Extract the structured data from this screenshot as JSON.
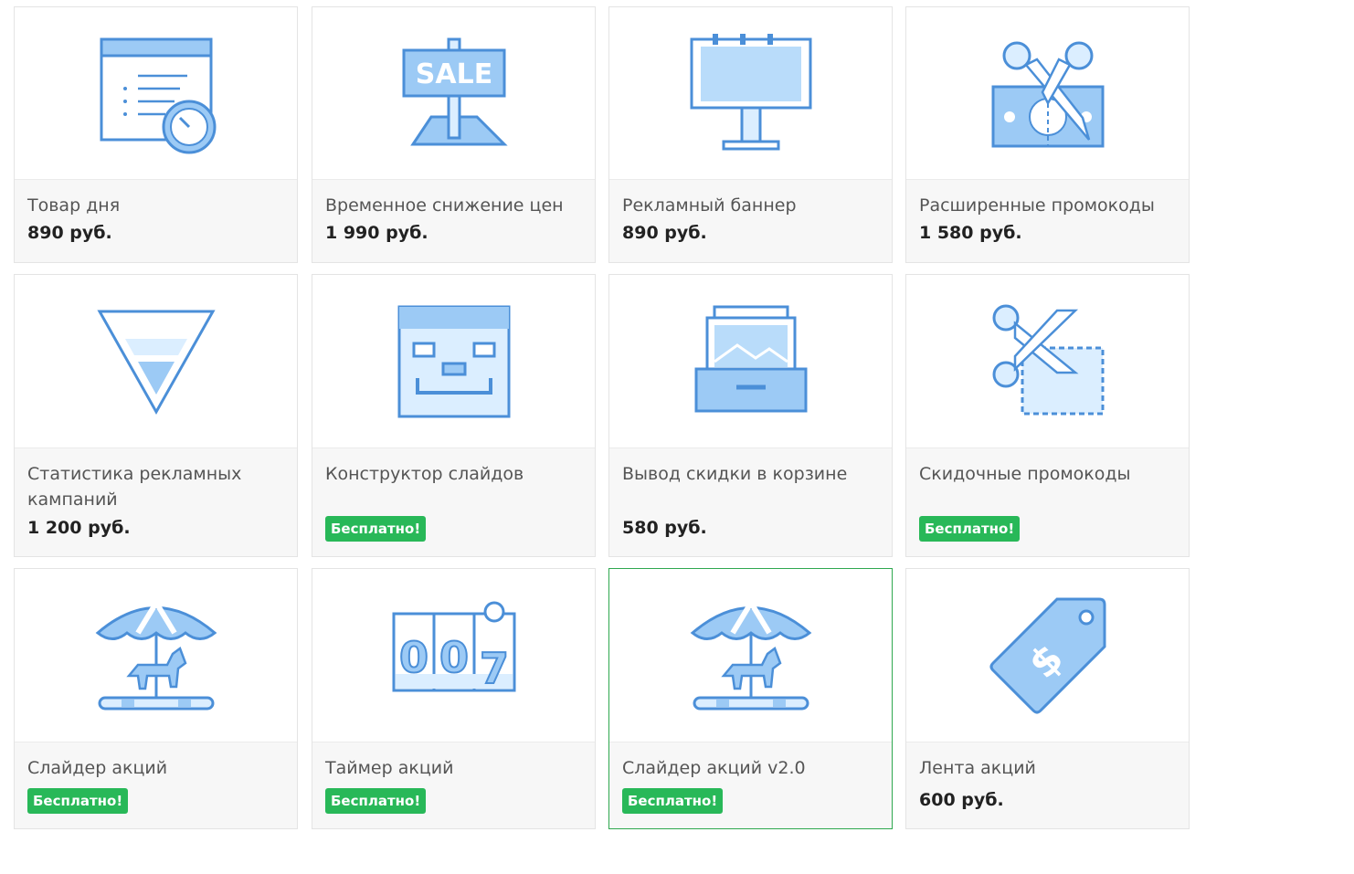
{
  "colors": {
    "icon_fill": "#9ccaf5",
    "icon_light": "#dbeeff",
    "icon_stroke": "#4b8fd8",
    "free_badge": "#28b858",
    "selected_border": "#2fa84f"
  },
  "products": [
    {
      "title": "Товар дня",
      "price": "890 руб.",
      "icon": "calendar-clock-icon"
    },
    {
      "title": "Временное снижение цен",
      "price": "1 990 руб.",
      "icon": "sale-sign-icon"
    },
    {
      "title": "Рекламный баннер",
      "price": "890 руб.",
      "icon": "billboard-icon"
    },
    {
      "title": "Расширенные промокоды",
      "price": "1 580 руб.",
      "icon": "cut-money-icon"
    },
    {
      "title": "Статистика рекламных кампаний",
      "price": "1 200 руб.",
      "icon": "funnel-icon"
    },
    {
      "title": "Конструктор слайдов",
      "badge": "Бесплатно!",
      "icon": "pixel-face-icon"
    },
    {
      "title": "Вывод скидки в корзине",
      "price": "580 руб.",
      "icon": "photo-drawer-icon"
    },
    {
      "title": "Скидочные промокоды",
      "badge": "Бесплатно!",
      "icon": "scissors-coupon-icon"
    },
    {
      "title": "Слайдер акций",
      "badge": "Бесплатно!",
      "icon": "carousel-icon"
    },
    {
      "title": "Таймер акций",
      "badge": "Бесплатно!",
      "icon": "flip-counter-icon",
      "counter_digits": [
        "0",
        "0",
        "7"
      ]
    },
    {
      "title": "Слайдер акций v2.0",
      "badge": "Бесплатно!",
      "icon": "carousel-icon",
      "selected": true
    },
    {
      "title": "Лента акций",
      "price": "600 руб.",
      "icon": "price-tag-icon"
    }
  ]
}
